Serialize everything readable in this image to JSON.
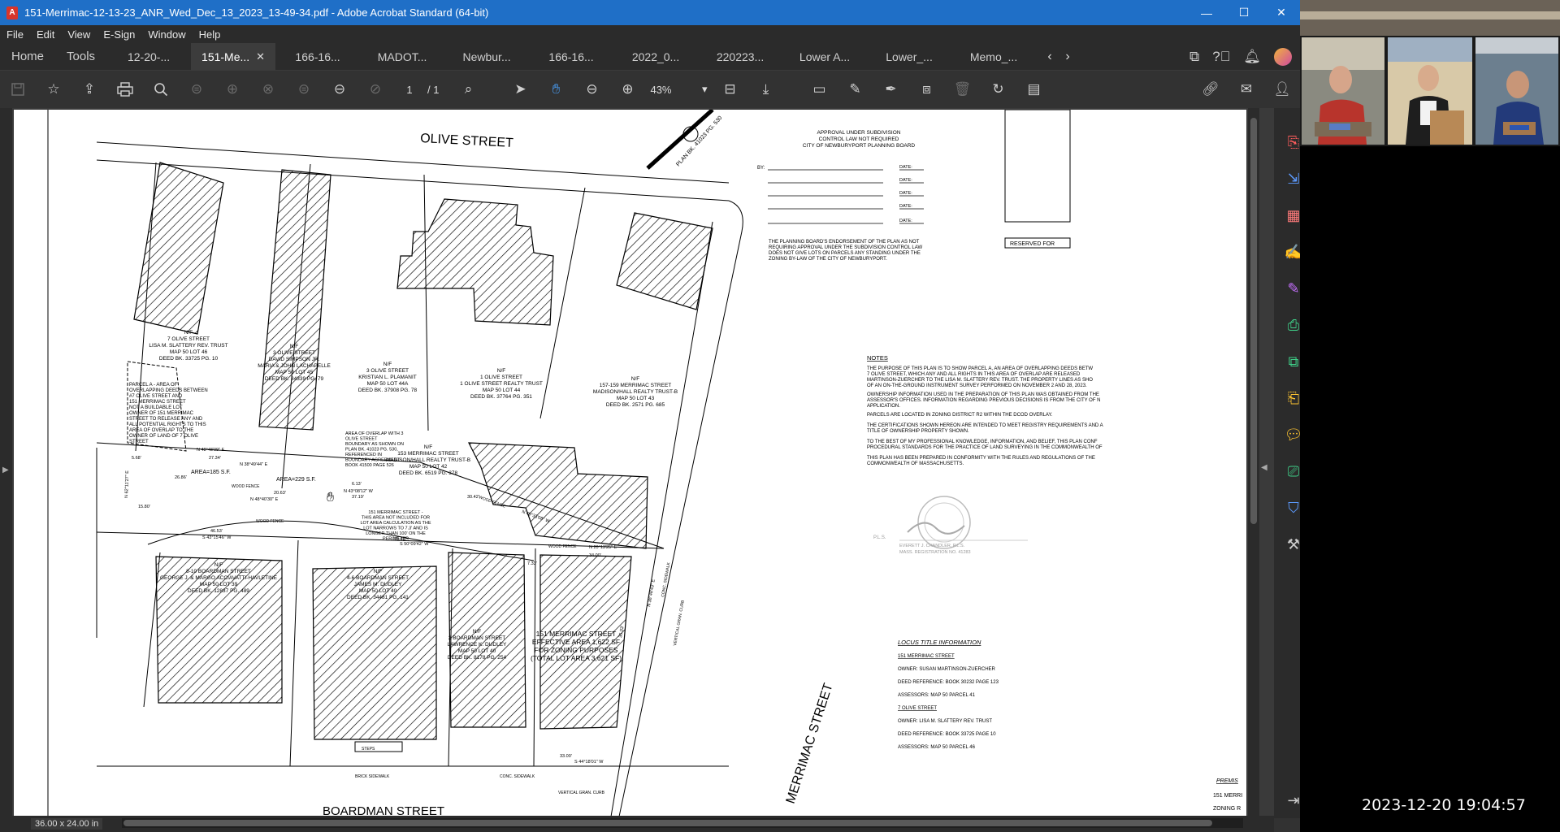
{
  "window": {
    "title": "151-Merrimac-12-13-23_ANR_Wed_Dec_13_2023_13-49-34.pdf - Adobe Acrobat Standard (64-bit)",
    "controls": [
      "—",
      "☐",
      "✕"
    ]
  },
  "menu": [
    "File",
    "Edit",
    "View",
    "E-Sign",
    "Window",
    "Help"
  ],
  "tabs": {
    "home": "Home",
    "tools": "Tools",
    "documents": [
      "12-20-...",
      "151-Me...",
      "166-16...",
      "MADOT...",
      "Newbur...",
      "166-16...",
      "2022_0...",
      "220223...",
      "Lower A...",
      "Lower_...",
      "Memo_..."
    ],
    "active_index": 1
  },
  "toolbar": {
    "page_current": "1",
    "page_total": "/ 1",
    "zoom": "43%"
  },
  "status": {
    "page_size": "36.00 x 24.00 in"
  },
  "video": {
    "timestamp": "2023-12-20  19:04:57"
  },
  "plan": {
    "streets": {
      "olive": "OLIVE STREET",
      "merrimac": "MERRIMAC STREET",
      "boardman": "BOARDMAN STREET"
    },
    "plan_ref": "PLAN BK. 41023 PG. 530",
    "approval": {
      "title": [
        "APPROVAL UNDER SUBDIVISION",
        "CONTROL LAW NOT REQUIRED",
        "CITY OF NEWBURYPORT PLANNING BOARD"
      ],
      "by": "BY:",
      "date": "DATE:",
      "endorsement": [
        "THE PLANNING BOARD'S ENDORSEMENT OF THE PLAN AS NOT",
        "REQUIRING APPROVAL UNDER THE SUBDIVISION CONTROL LAW",
        "DOES NOT GIVE LOTS ON PARCELS ANY STANDING UNDER THE",
        "ZONING BY-LAW OF THE CITY OF NEWBURYPORT."
      ],
      "reserved": "RESERVED FOR"
    },
    "notes": {
      "heading": "NOTES",
      "items": [
        "THE PURPOSE OF THIS PLAN IS TO SHOW PARCEL A, AN AREA OF OVERLAPPING DEEDS BETW",
        "7 OLIVE STREET, WHICH ANY AND ALL RIGHTS IN THIS AREA OF OVERLAP ARE RELEASED",
        "MARTINSON-ZUERCHER TO THE LISA M. SLATTERY REV. TRUST. THE PROPERTY LINES AS SHO",
        "OF AN ON-THE-GROUND INSTRUMENT SURVEY PERFORMED ON NOVEMBER 2 AND 28, 2023.",
        "OWNERSHIP INFORMATION USED IN THE PREPARATION OF THIS PLAN WAS OBTAINED FROM THE",
        "ASSESSOR'S OFFICES. INFORMATION REGARDING PREVIOUS DECISIONS IS FROM THE CITY OF N",
        "APPLICATION.",
        "PARCELS ARE LOCATED IN ZONING DISTRICT R2 WITHIN THE DCOD OVERLAY.",
        "THE CERTIFICATIONS SHOWN HEREON ARE INTENDED TO MEET REGISTRY REQUIREMENTS AND A",
        "TITLE OF OWNERSHIP PROPERTY SHOWN.",
        "TO THE BEST OF MY PROFESSIONAL KNOWLEDGE, INFORMATION, AND BELIEF, THIS PLAN CONF",
        "PROCEDURAL STANDARDS FOR THE PRACTICE OF LAND SURVEYING IN THE COMMONWEALTH OF",
        "THIS PLAN HAS BEEN PREPARED IN CONFORMITY WITH THE RULES AND REGULATIONS OF THE",
        "COMMONWEALTH OF MASSACHUSETTS."
      ]
    },
    "surveyor": {
      "prefix": "P.L.S.",
      "name": "EVERETT J. CHANDLER, P.L.S.",
      "reg": "MASS. REGISTRATION NO. 41283"
    },
    "locus": {
      "heading": "LOCUS TITLE INFORMATION",
      "lines": [
        "151 MERRIMAC STREET",
        "OWNER:  SUSAN MARTINSON-ZUERCHER",
        "DEED REFERENCE:  BOOK 30232 PAGE 123",
        "ASSESSORS:  MAP 50 PARCEL 41",
        "7 OLIVE STREET",
        "OWNER:  LISA M. SLATTERY REV. TRUST",
        "DEED REFERENCE:  BOOK 33725 PAGE 10",
        "ASSESSORS:  MAP 50 PARCEL 46"
      ]
    },
    "premises": [
      "PREMIS",
      "151 MERRI",
      "ZONING R"
    ],
    "lots": [
      {
        "text": [
          "N/F",
          "7 OLIVE STREET",
          "LISA M. SLATTERY REV. TRUST",
          "MAP 50 LOT 46",
          "DEED BK. 33725 PG. 10"
        ]
      },
      {
        "text": [
          "N/F",
          "3 OLIVE STREET",
          "DAVID SIMPSON JR.",
          "MARIA & JOHN LACHAPELLE",
          "MAP 50 LOT 45",
          "DEED BK. 34339 PG. 79"
        ]
      },
      {
        "text": [
          "N/F",
          "3 OLIVE STREET",
          "KRISTIAN L. PLAMANIT",
          "MAP 50 LOT 44A",
          "DEED BK. 37908 PG. 78"
        ]
      },
      {
        "text": [
          "N/F",
          "1 OLIVE STREET",
          "1 OLIVE STREET REALTY TRUST",
          "MAP 50 LOT 44",
          "DEED BK. 37764 PG. 351"
        ]
      },
      {
        "text": [
          "N/F",
          "157-159 MERRIMAC STREET",
          "MADISON/HALL REALTY TRUST-B",
          "MAP 50 LOT 43",
          "DEED BK. 2571 PG. 685"
        ]
      },
      {
        "text": [
          "N/F",
          "153 MERRIMAC STREET",
          "MADISON/HALL REALTY TRUST-B",
          "MAP 50 LOT 42",
          "DEED BK. 6519 PG. 378"
        ]
      },
      {
        "text": [
          "N/F",
          "8-10 BOARDMAN STREET",
          "GEORGE J. & MARGO ACCIAVATTI-HAVLETINE",
          "MAP 50 LOT 39",
          "DEED BK. 12837 PG. 489"
        ]
      },
      {
        "text": [
          "N/F",
          "4-6 BOARDMAN STREET",
          "JAMES M. DUDLEY",
          "MAP 50 LOT 40",
          "DEED BK. 34481 PG. 141"
        ]
      },
      {
        "text": [
          "N/F",
          "2 BOARDMAN STREET",
          "LAWRENCE K. DUDLEY",
          "MAP 50 LOT 40",
          "DEED BK. 8178 PG. 254"
        ]
      }
    ],
    "parcel_a": [
      "PARCEL A - AREA OF",
      "OVERLAPPING DEEDS BETWEEN",
      "#7 OLIVE STREET AND",
      "151 MERRIMAC STREET",
      "",
      "NOT A BUILDABLE LOT",
      "",
      "OWNER OF 151 MERRIMAC",
      "STREET TO RELEASE ANY AND",
      "ALL POTENTIAL RIGHTS TO THIS",
      "AREA OF OVERLAP TO THE",
      "OWNER OF LAND OF 7 OLIVE",
      "STREET"
    ],
    "overlap_note": [
      "AREA OF OVERLAP WITH 3",
      "OLIVE STREET",
      "BOUNDARY AS SHOWN ON",
      "PLAN BK. 41023 PG. 530,",
      "REFERENCED IN",
      "BOUNDARY AGREEMENT",
      "BOOK 41500 PAGE 526"
    ],
    "sliver_note": [
      "151 MERRIMAC STREET -",
      "THIS AREA NOT INCLUDED FOR",
      "LOT AREA CALCULATION AS THE",
      "LOT NARROWS TO 7.3' AND IS",
      "LONGER THAN 100' ON THE",
      "PERIMETER"
    ],
    "subject": [
      "151 MERRIMAC STREET",
      "EFFECTIVE AREA 1,622 SF",
      "FOR ZONING PURPOSES",
      "(TOTAL LOT AREA 3,621 SF)"
    ],
    "areas": [
      "AREA=185 S.F.",
      "AREA=229 S.F."
    ],
    "bearings": [
      "N 48°48'09\" E",
      "N 38°49'44\" E",
      "N 43°08'12\" W",
      "N 48°40'30\" E",
      "N 62°11'27\" E",
      "N 49°33'08\" W",
      "S 43°15'46\" W",
      "S 50°09'42\" W",
      "S 44°18'01\" W",
      "N 20°13'25\" E",
      "N 38°48'43\" E"
    ],
    "distances": [
      "27.34'",
      "26.86'",
      "20.63'",
      "37.19'",
      "6.13'",
      "46.53'",
      "70.42'",
      "34.00'",
      "33.00'",
      "30.42'",
      "5.68'",
      "7.33'",
      "15.80'",
      "35.03'"
    ],
    "misc_labels": [
      "WOOD FENCE",
      "WOOD FENCE",
      "WOOD FENCE",
      "WOOD FENCE",
      "STEPS",
      "BRICK SIDEWALK",
      "CONC. SIDEWALK",
      "VERTICAL GRAN. CURB",
      "CONC. SIDEWALK",
      "VERTICAL GRAN. CURB"
    ]
  }
}
